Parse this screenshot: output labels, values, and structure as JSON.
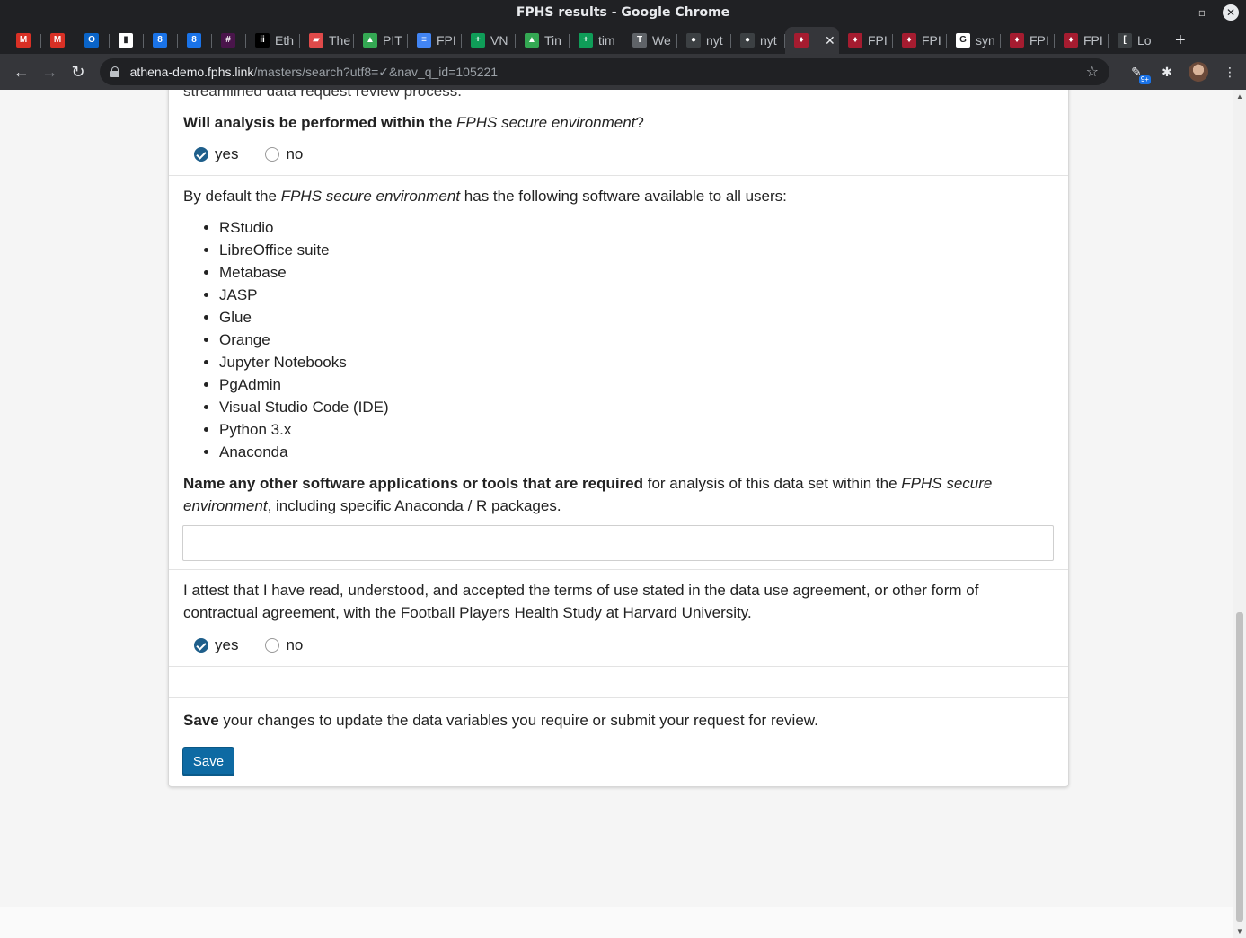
{
  "window": {
    "title": "FPHS results - Google Chrome",
    "minimize_glyph": "–",
    "restore_glyph": "▫",
    "close_glyph": "✕"
  },
  "tabs": [
    {
      "label": "",
      "icon": "gmail-icon",
      "glyph": "M",
      "color": "#d93025"
    },
    {
      "label": "",
      "icon": "gmail-icon",
      "glyph": "M",
      "color": "#d93025"
    },
    {
      "label": "",
      "icon": "outlook-icon",
      "glyph": "O",
      "color": "#0a64c8"
    },
    {
      "label": "",
      "icon": "trello-icon",
      "glyph": "▮",
      "color": "#ffffff"
    },
    {
      "label": "",
      "icon": "calendar-icon",
      "glyph": "8",
      "color": "#1a73e8"
    },
    {
      "label": "",
      "icon": "calendar-icon",
      "glyph": "8",
      "color": "#1a73e8"
    },
    {
      "label": "",
      "icon": "slack-icon",
      "glyph": "#",
      "color": "#4a154b"
    },
    {
      "label": "Eth",
      "icon": "ii-icon",
      "glyph": "ii",
      "color": "#000000"
    },
    {
      "label": "The",
      "icon": "ticket-icon",
      "glyph": "▰",
      "color": "#e04a4a"
    },
    {
      "label": "PIT",
      "icon": "drive-icon",
      "glyph": "▲",
      "color": "#34a853"
    },
    {
      "label": "FPI",
      "icon": "docs-icon",
      "glyph": "≡",
      "color": "#4285f4"
    },
    {
      "label": "VN",
      "icon": "sheets-icon",
      "glyph": "+",
      "color": "#0f9d58"
    },
    {
      "label": "Tin",
      "icon": "drive-icon",
      "glyph": "▲",
      "color": "#34a853"
    },
    {
      "label": "tim",
      "icon": "sheets-icon",
      "glyph": "+",
      "color": "#0f9d58"
    },
    {
      "label": "We",
      "icon": "nyt-icon",
      "glyph": "T",
      "color": "#5f6368"
    },
    {
      "label": "nyt",
      "icon": "github-icon",
      "glyph": "●",
      "color": "#3c4043"
    },
    {
      "label": "nyt",
      "icon": "github-icon",
      "glyph": "●",
      "color": "#3c4043"
    },
    {
      "label": "",
      "icon": "harvard-shield-icon",
      "glyph": "♦",
      "color": "#a51c30",
      "active": true
    },
    {
      "label": "FPI",
      "icon": "harvard-shield-icon",
      "glyph": "♦",
      "color": "#a51c30"
    },
    {
      "label": "FPI",
      "icon": "harvard-shield-icon",
      "glyph": "♦",
      "color": "#a51c30"
    },
    {
      "label": "syn",
      "icon": "google-icon",
      "glyph": "G",
      "color": "#ffffff"
    },
    {
      "label": "FPI",
      "icon": "harvard-shield-icon",
      "glyph": "♦",
      "color": "#a51c30"
    },
    {
      "label": "FPI",
      "icon": "harvard-shield-icon",
      "glyph": "♦",
      "color": "#a51c30"
    },
    {
      "label": "Lo",
      "icon": "bracket-icon",
      "glyph": "[",
      "color": "#3c4043"
    }
  ],
  "tab_close_glyph": "✕",
  "new_tab_glyph": "+",
  "toolbar": {
    "back_glyph": "←",
    "forward_glyph": "→",
    "reload_glyph": "↻",
    "url_host": "athena-demo.fphs.link",
    "url_path": "/masters/search?utf8=✓&nav_q_id=105221",
    "star_glyph": "☆",
    "ext_badge": "9+",
    "ext_glyph": "✎",
    "puzzle_glyph": "✱",
    "menu_glyph": "⋮"
  },
  "form": {
    "prev_text": "streamlined data request review process.",
    "q1": {
      "bold": "Will analysis be performed within the ",
      "italic": "FPHS secure environment",
      "tail": "?",
      "options": [
        "yes",
        "no"
      ],
      "selected": "yes"
    },
    "software": {
      "intro_pre": "By default the ",
      "intro_italic": "FPHS secure environment",
      "intro_post": " has the following software available to all users:",
      "items": [
        "RStudio",
        "LibreOffice suite",
        "Metabase",
        "JASP",
        "Glue",
        "Orange",
        "Jupyter Notebooks",
        "PgAdmin",
        "Visual Studio Code (IDE)",
        "Python 3.x",
        "Anaconda"
      ]
    },
    "q2": {
      "bold": "Name any other software applications or tools that are required",
      "mid": " for analysis of this data set within the ",
      "italic": "FPHS secure environment",
      "tail": ", including specific Anaconda / R packages.",
      "value": ""
    },
    "q3": {
      "text": "I attest that I have read, understood, and accepted the terms of use stated in the data use agreement, or other form of contractual agreement, with the Football Players Health Study at Harvard University.",
      "options": [
        "yes",
        "no"
      ],
      "selected": "yes"
    },
    "save": {
      "bold": "Save",
      "text": " your changes to update the data variables you require or submit your request for review.",
      "button_label": "Save"
    }
  },
  "colors": {
    "accent": "#0e6aa3",
    "chrome_dark": "#202124",
    "chrome_toolbar": "#35363a"
  }
}
